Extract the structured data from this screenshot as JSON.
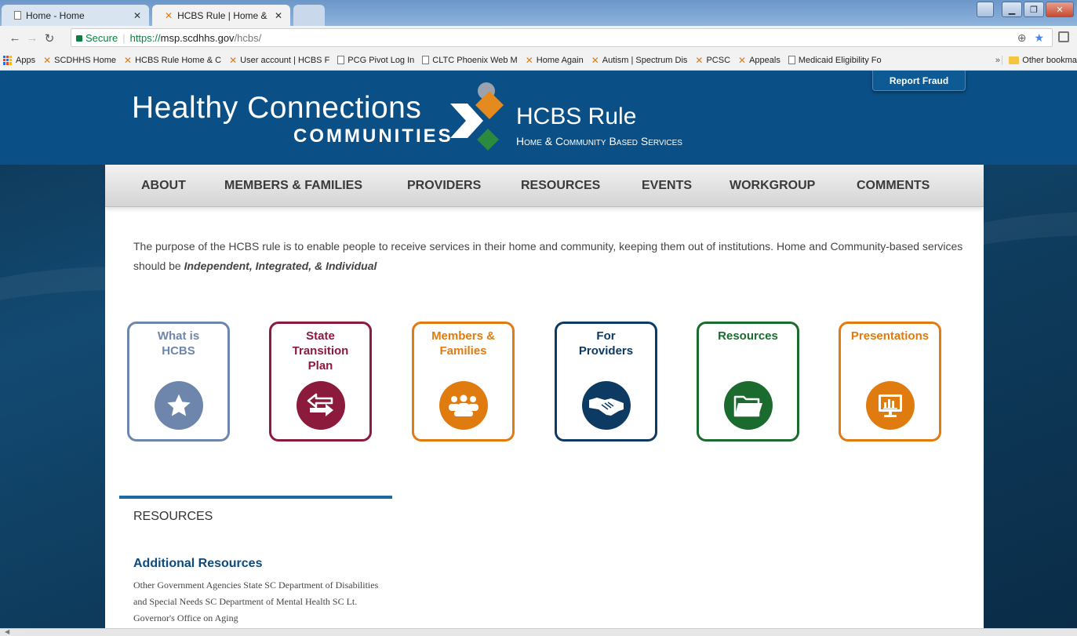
{
  "browser": {
    "tabs": [
      {
        "title": "Home - Home",
        "active": false
      },
      {
        "title": "HCBS Rule | Home & Cor",
        "active": true
      }
    ],
    "url": {
      "secure_label": "Secure",
      "scheme": "https://",
      "host": "msp.scdhhs.gov",
      "path": "/hcbs/"
    },
    "bookmarks": [
      {
        "label": "Apps",
        "icon": "apps-grid-icon"
      },
      {
        "label": "SCDHHS Home",
        "icon": "scdhhs-x-icon"
      },
      {
        "label": "HCBS Rule  Home & C",
        "icon": "scdhhs-x-icon"
      },
      {
        "label": "User account | HCBS F",
        "icon": "scdhhs-x-icon"
      },
      {
        "label": "PCG Pivot Log In",
        "icon": "document-icon"
      },
      {
        "label": "CLTC Phoenix Web M",
        "icon": "document-icon"
      },
      {
        "label": "Home Again",
        "icon": "scdhhs-x-icon"
      },
      {
        "label": "Autism | Spectrum Dis",
        "icon": "scdhhs-x-icon"
      },
      {
        "label": "PCSC",
        "icon": "scdhhs-x-icon"
      },
      {
        "label": "Appeals",
        "icon": "scdhhs-x-icon"
      },
      {
        "label": "Medicaid Eligibility Fo",
        "icon": "document-icon"
      }
    ],
    "bookmarks_more": "»",
    "other_bookmarks": "Other bookma"
  },
  "header": {
    "logo_main": "Healthy Connections",
    "logo_sub": "COMMUNITIES",
    "site_title": "HCBS Rule",
    "site_subtitle": "Home & Community Based Services",
    "report_fraud": "Report Fraud",
    "colors": {
      "header_bg": "#0a4f86",
      "logo_blue": "#6a8fc4",
      "logo_orange": "#e58a1f",
      "logo_green": "#2b8a3e",
      "logo_gray": "#9aa3ad"
    }
  },
  "nav": {
    "items": [
      "ABOUT",
      "MEMBERS & FAMILIES",
      "PROVIDERS",
      "RESOURCES",
      "EVENTS",
      "WORKGROUP",
      "COMMENTS"
    ]
  },
  "intro": {
    "text": "The purpose of the HCBS rule is to enable people to receive services in their home and community, keeping them out of institutions. Home and Community-based services should be ",
    "emphasis": "Independent, Integrated, & Individual"
  },
  "cards": [
    {
      "label": "What is\nHCBS",
      "color": "#6e86ac",
      "icon": "star-icon"
    },
    {
      "label": "State\nTransition\nPlan",
      "color": "#8b1a3c",
      "icon": "exchange-arrows-icon"
    },
    {
      "label": "Members &\nFamilies",
      "color": "#e07b10",
      "icon": "people-group-icon"
    },
    {
      "label": "For\nProviders",
      "color": "#0d3a63",
      "icon": "handshake-icon"
    },
    {
      "label": "Resources",
      "color": "#1b6b2f",
      "icon": "folder-icon"
    },
    {
      "label": "Presentations",
      "color": "#e07b10",
      "icon": "presentation-chart-icon"
    }
  ],
  "resources": {
    "heading": "RESOURCES",
    "additional_title": "Additional Resources",
    "additional_text": "Other Government Agencies State SC Department of Disabilities and Special Needs SC Department of Mental Health SC Lt. Governor's Office on Aging"
  }
}
